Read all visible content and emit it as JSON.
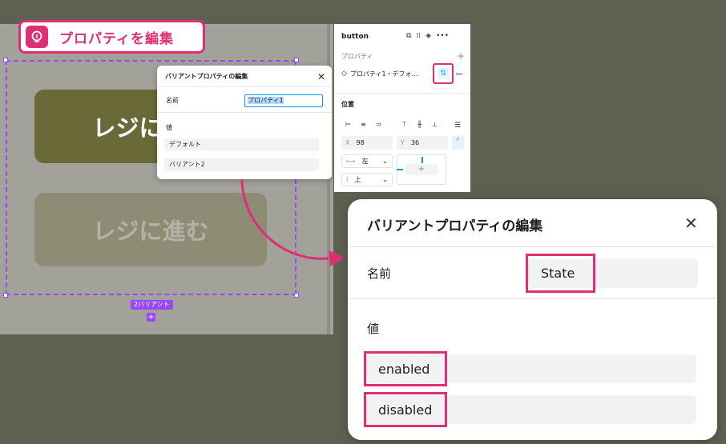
{
  "callout": {
    "title": "プロパティを編集",
    "icon": "lightbulb-icon"
  },
  "canvas": {
    "buttons": [
      {
        "label": "レジに進む",
        "state": "enabled"
      },
      {
        "label": "レジに進む",
        "state": "disabled"
      }
    ],
    "variant_count_label": "2バリアント",
    "add_variant_glyph": "+"
  },
  "small_dialog": {
    "title": "バリアントプロパティの編集",
    "name_label": "名前",
    "name_value": "プロパティ1",
    "value_label": "値",
    "values": [
      "デフォルト",
      "バリアント2"
    ]
  },
  "panel": {
    "title": "button",
    "properties_heading": "プロパティ",
    "property_label": "プロパティ1・デフォ…",
    "position_heading": "位置",
    "x_label": "X",
    "x_value": "98",
    "y_label": "Y",
    "y_value": "36",
    "horizontal_constraint": "左",
    "vertical_constraint": "上"
  },
  "large_dialog": {
    "title": "バリアントプロパティの編集",
    "name_label": "名前",
    "name_value": "State",
    "value_label": "値",
    "values": [
      "enabled",
      "disabled"
    ]
  },
  "colors": {
    "highlight": "#de2f74",
    "selection": "#9747ff",
    "accent_blue": "#0d99ff"
  }
}
